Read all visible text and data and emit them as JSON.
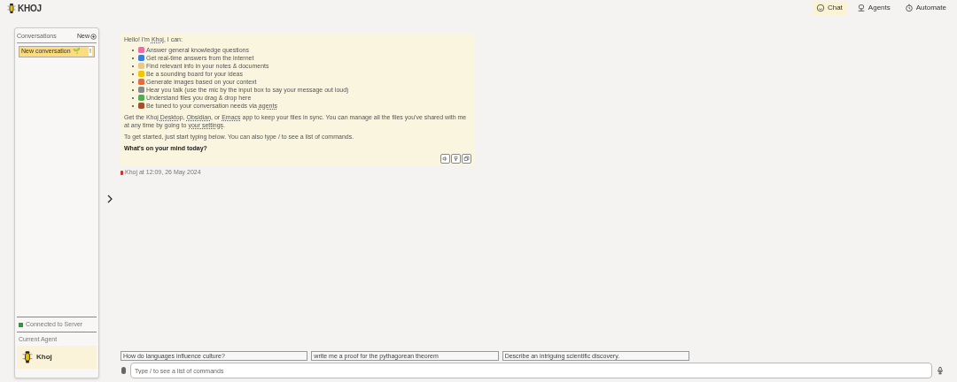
{
  "app": {
    "name": "KHOJ"
  },
  "nav": [
    {
      "label": "Chat",
      "selected": true
    },
    {
      "label": "Agents",
      "selected": false
    },
    {
      "label": "Automate",
      "selected": false
    }
  ],
  "sidebar": {
    "title": "Conversations",
    "new_label": "New",
    "conversations": [
      {
        "label": "New conversation 🌱",
        "selected": true,
        "menu": "!"
      }
    ],
    "status": {
      "text": "Connected to Server",
      "color": "#22a22a"
    },
    "agent_heading": "Current Agent",
    "agent": {
      "name": "Khoj"
    }
  },
  "message": {
    "greeting": [
      "Hello! I'm ",
      "Khoj",
      ", I can:"
    ],
    "bullets": [
      [
        "Answer general knowledge questions"
      ],
      [
        "Get real-time answers from the internet"
      ],
      [
        "Find relevant info in your notes & documents"
      ],
      [
        "Be a sounding board for your ideas"
      ],
      [
        "Generate images based on your context"
      ],
      [
        "Hear you talk (use the mic by the input box to say your message out loud)"
      ],
      [
        "Understand files you drag & drop here"
      ],
      [
        "Be tuned to your conversation needs via ",
        "agents"
      ]
    ],
    "sync": [
      "Get the Khoj ",
      "Desktop",
      ", ",
      "Obsidian",
      ", or ",
      "Emacs",
      " app to keep your files in sync. You can manage all the files you've shared with me at any time by going to ",
      "your settings",
      "."
    ],
    "hint": "To get started, just start typing below. You can also type / to see a list of commands.",
    "question": "What's on your mind today?",
    "footer": "Khoj at 12:09, 26 May 2024"
  },
  "suggestions": [
    "How do languages influence culture?",
    "write me a proof for the pythagorean theorem",
    "Describe an intriguing scientific discovery."
  ],
  "input": {
    "placeholder": "Type / to see a list of commands"
  }
}
